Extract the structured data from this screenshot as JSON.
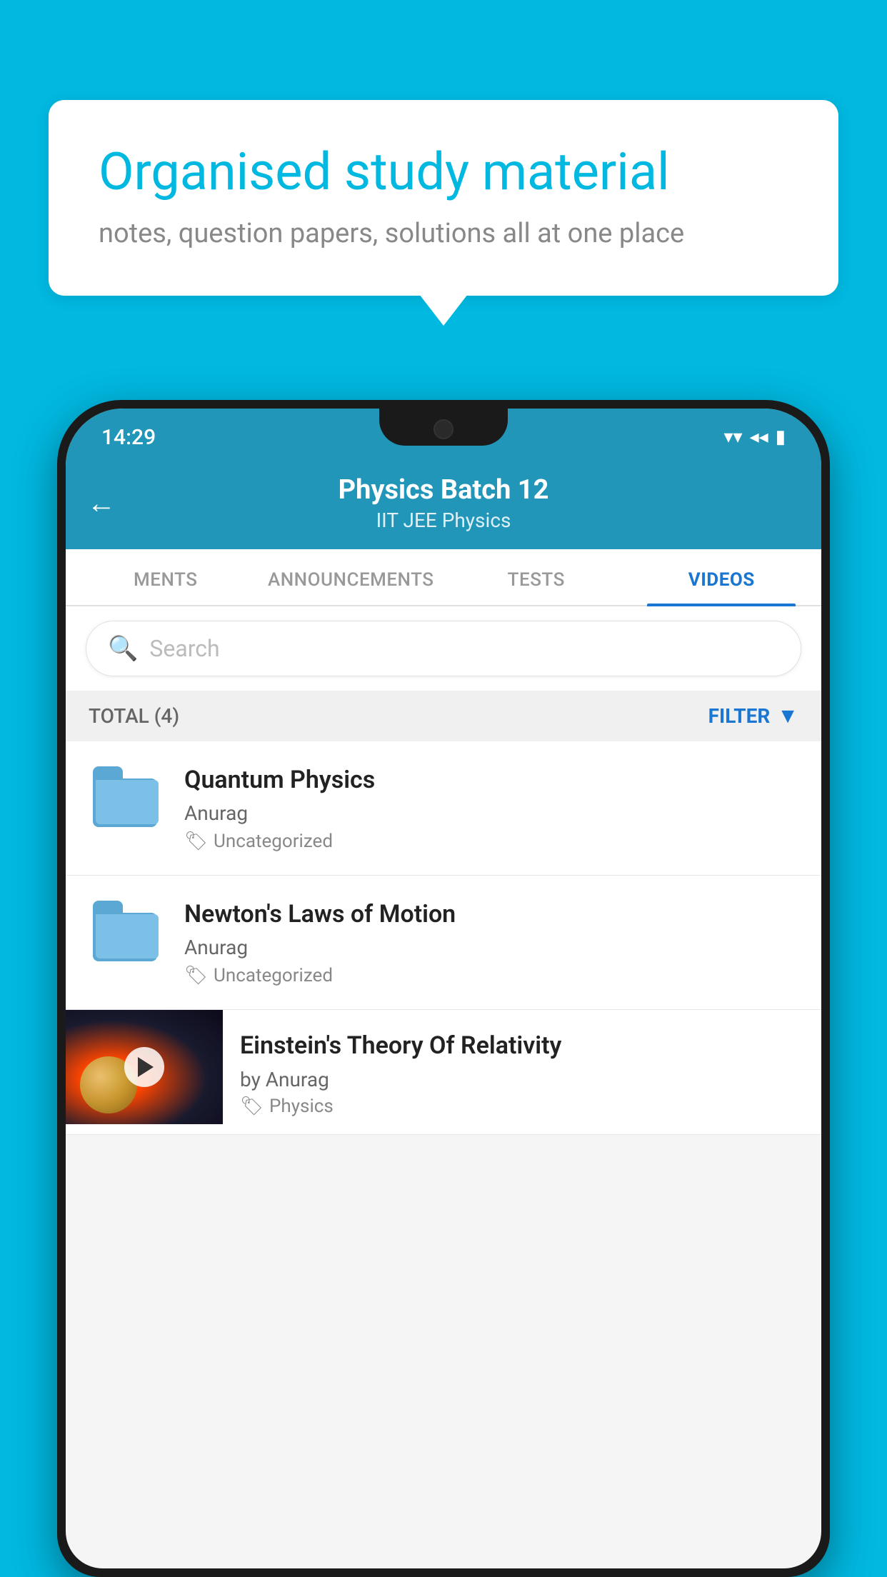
{
  "background_color": "#00b8e0",
  "bubble": {
    "title": "Organised study material",
    "subtitle": "notes, question papers, solutions all at one place"
  },
  "status_bar": {
    "time": "14:29",
    "wifi": "▼",
    "signal": "◀",
    "battery": "▮"
  },
  "header": {
    "back_label": "←",
    "title": "Physics Batch 12",
    "subtitle": "IIT JEE   Physics"
  },
  "tabs": [
    {
      "label": "MENTS",
      "active": false
    },
    {
      "label": "ANNOUNCEMENTS",
      "active": false
    },
    {
      "label": "TESTS",
      "active": false
    },
    {
      "label": "VIDEOS",
      "active": true
    }
  ],
  "search": {
    "placeholder": "Search"
  },
  "filter_bar": {
    "total_label": "TOTAL (4)",
    "filter_label": "FILTER"
  },
  "videos": [
    {
      "title": "Quantum Physics",
      "author": "Anurag",
      "tag": "Uncategorized",
      "has_thumb": false
    },
    {
      "title": "Newton's Laws of Motion",
      "author": "Anurag",
      "tag": "Uncategorized",
      "has_thumb": false
    },
    {
      "title": "Einstein's Theory Of Relativity",
      "author": "by Anurag",
      "tag": "Physics",
      "has_thumb": true
    }
  ]
}
